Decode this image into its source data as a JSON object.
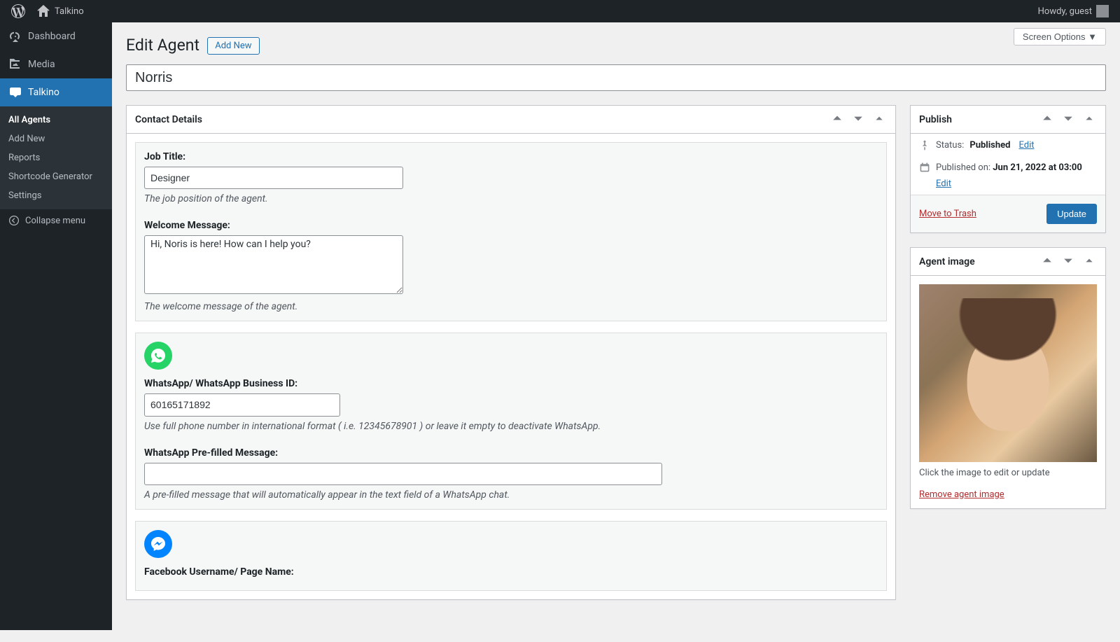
{
  "adminbar": {
    "site_name": "Talkino",
    "howdy": "Howdy, guest"
  },
  "sidebar": {
    "dashboard": "Dashboard",
    "media": "Media",
    "talkino": "Talkino",
    "submenu": {
      "all_agents": "All Agents",
      "add_new": "Add New",
      "reports": "Reports",
      "shortcode": "Shortcode Generator",
      "settings": "Settings"
    },
    "collapse": "Collapse menu"
  },
  "screen_options": "Screen Options",
  "page": {
    "title": "Edit Agent",
    "add_new": "Add New",
    "agent_name": "Norris"
  },
  "contact": {
    "heading": "Contact Details",
    "job_title_label": "Job Title:",
    "job_title_value": "Designer",
    "job_title_desc": "The job position of the agent.",
    "welcome_label": "Welcome Message:",
    "welcome_value": "Hi, Noris is here! How can I help you?",
    "welcome_desc": "The welcome message of the agent.",
    "whatsapp_id_label": "WhatsApp/ WhatsApp Business ID:",
    "whatsapp_id_value": "60165171892",
    "whatsapp_id_desc": "Use full phone number in international format ( i.e. 12345678901 ) or leave it empty to deactivate WhatsApp.",
    "whatsapp_pre_label": "WhatsApp Pre-filled Message:",
    "whatsapp_pre_value": "",
    "whatsapp_pre_desc": "A pre-filled message that will automatically appear in the text field of a WhatsApp chat.",
    "facebook_label": "Facebook Username/ Page Name:"
  },
  "publish": {
    "heading": "Publish",
    "status_label": "Status:",
    "status_value": "Published",
    "edit": "Edit",
    "published_label": "Published on:",
    "published_value": "Jun 21, 2022 at 03:00",
    "trash": "Move to Trash",
    "update": "Update"
  },
  "agent_image": {
    "heading": "Agent image",
    "desc": "Click the image to edit or update",
    "remove": "Remove agent image"
  }
}
